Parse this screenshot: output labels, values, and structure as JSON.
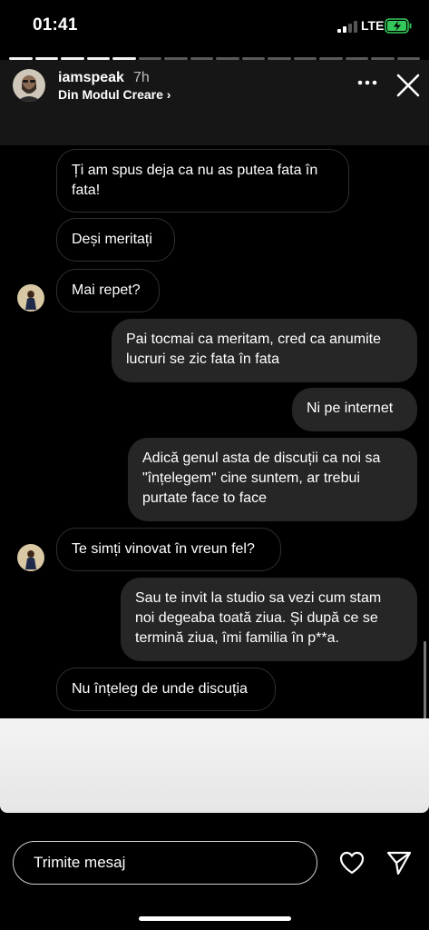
{
  "status_bar": {
    "time": "01:41",
    "network": "LTE"
  },
  "story": {
    "segments_total": 16,
    "segments_viewed": 5
  },
  "header": {
    "username": "iamspeak",
    "time_ago": "7h",
    "subtitle": "Din Modul Creare",
    "subtitle_chevron": "›"
  },
  "messages": [
    {
      "side": "in",
      "text_lines": [
        "Ți am spus deja ca nu as putea fata în",
        "fata!"
      ]
    },
    {
      "side": "in",
      "text": "Deși meritați"
    },
    {
      "side": "in",
      "text": "Mai repet?"
    },
    {
      "side": "out",
      "text_lines": [
        "Pai tocmai ca meritam, cred ca anumite",
        "lucruri se zic fata în fata"
      ]
    },
    {
      "side": "out",
      "text": "Ni pe internet"
    },
    {
      "side": "out",
      "text_lines": [
        "Adică genul asta de discuții ca noi sa",
        "\"înțelegem\" cine suntem, ar trebui",
        "purtate face to face"
      ]
    },
    {
      "side": "in",
      "text": "Te simți vinovat în vreun fel?"
    },
    {
      "side": "out",
      "text_lines": [
        "Sau te invit la studio sa vezi cum stam",
        "noi degeaba toată ziua. Și după ce se",
        "termină ziua, îmi familia în p**a."
      ]
    },
    {
      "side": "in",
      "text": "Nu înțeleg de unde discuția"
    }
  ],
  "footer": {
    "input_placeholder": "Trimite mesaj"
  },
  "icons": {
    "more": "more-horizontal-icon",
    "close": "close-icon",
    "heart": "heart-icon",
    "send": "send-icon",
    "battery_accent": "#34c759"
  }
}
